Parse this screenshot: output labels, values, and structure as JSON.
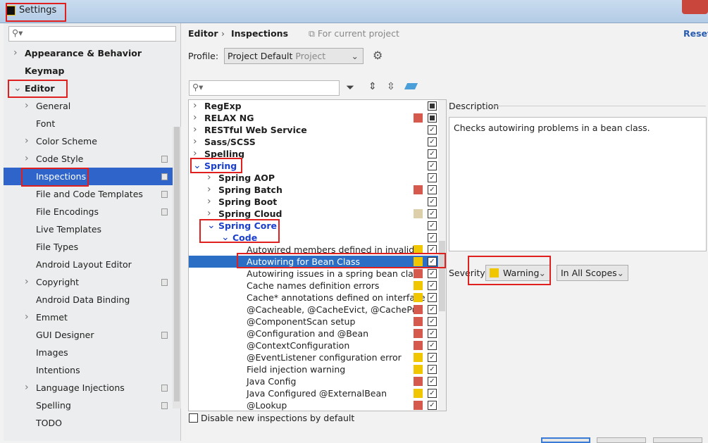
{
  "window": {
    "title": "Settings"
  },
  "sidebar": {
    "search_placeholder": "",
    "items": [
      {
        "label": "Appearance & Behavior",
        "level": 0,
        "bold": true,
        "chevron": "right"
      },
      {
        "label": "Keymap",
        "level": 0,
        "bold": true
      },
      {
        "label": "Editor",
        "level": 0,
        "bold": true,
        "chevron": "down"
      },
      {
        "label": "General",
        "level": 1,
        "chevron": "right"
      },
      {
        "label": "Font",
        "level": 1
      },
      {
        "label": "Color Scheme",
        "level": 1,
        "chevron": "right"
      },
      {
        "label": "Code Style",
        "level": 1,
        "chevron": "right",
        "copy": true
      },
      {
        "label": "Inspections",
        "level": 1,
        "selected": true,
        "copy": true
      },
      {
        "label": "File and Code Templates",
        "level": 1,
        "copy": true
      },
      {
        "label": "File Encodings",
        "level": 1,
        "copy": true
      },
      {
        "label": "Live Templates",
        "level": 1
      },
      {
        "label": "File Types",
        "level": 1
      },
      {
        "label": "Android Layout Editor",
        "level": 1
      },
      {
        "label": "Copyright",
        "level": 1,
        "chevron": "right",
        "copy": true
      },
      {
        "label": "Android Data Binding",
        "level": 1
      },
      {
        "label": "Emmet",
        "level": 1,
        "chevron": "right"
      },
      {
        "label": "GUI Designer",
        "level": 1,
        "copy": true
      },
      {
        "label": "Images",
        "level": 1
      },
      {
        "label": "Intentions",
        "level": 1
      },
      {
        "label": "Language Injections",
        "level": 1,
        "chevron": "right",
        "copy": true
      },
      {
        "label": "Spelling",
        "level": 1,
        "copy": true
      },
      {
        "label": "TODO",
        "level": 1
      }
    ]
  },
  "header": {
    "breadcrumb_1": "Editor",
    "separator": "›",
    "breadcrumb_2": "Inspections",
    "scope_note": "For current project",
    "reset": "Reset"
  },
  "profile": {
    "label": "Profile:",
    "value": "Project Default",
    "value_suffix": "Project"
  },
  "tree": {
    "search_placeholder": "",
    "rows": [
      {
        "label": "RegExp",
        "level": 0,
        "bold": true,
        "chevron": "right",
        "sev": "",
        "check": "partial"
      },
      {
        "label": "RELAX NG",
        "level": 0,
        "bold": true,
        "chevron": "right",
        "sev": "red",
        "check": "partial"
      },
      {
        "label": "RESTful Web Service",
        "level": 0,
        "bold": true,
        "chevron": "right",
        "sev": "",
        "check": "checked"
      },
      {
        "label": "Sass/SCSS",
        "level": 0,
        "bold": true,
        "chevron": "right",
        "sev": "",
        "check": "checked"
      },
      {
        "label": "Spelling",
        "level": 0,
        "bold": true,
        "chevron": "right",
        "sev": "",
        "check": "checked"
      },
      {
        "label": "Spring",
        "level": 0,
        "bold": true,
        "blue": true,
        "chevron": "down",
        "sev": "",
        "check": "checked"
      },
      {
        "label": "Spring AOP",
        "level": 1,
        "bold": true,
        "chevron": "right",
        "sev": "",
        "check": "checked"
      },
      {
        "label": "Spring Batch",
        "level": 1,
        "bold": true,
        "chevron": "right",
        "sev": "red",
        "check": "checked"
      },
      {
        "label": "Spring Boot",
        "level": 1,
        "bold": true,
        "chevron": "right",
        "sev": "",
        "check": "checked"
      },
      {
        "label": "Spring Cloud",
        "level": 1,
        "bold": true,
        "chevron": "right",
        "sev": "tan",
        "check": "checked"
      },
      {
        "label": "Spring Core",
        "level": 1,
        "bold": true,
        "blue": true,
        "chevron": "down",
        "sev": "",
        "check": "checked"
      },
      {
        "label": "Code",
        "level": 2,
        "bold": true,
        "blue": true,
        "chevron": "down",
        "sev": "",
        "check": "checked"
      },
      {
        "label": "Autowired members defined in invalid S",
        "level": 3,
        "sev": "yellow",
        "check": "checked"
      },
      {
        "label": "Autowiring for Bean Class",
        "level": 3,
        "sev": "yellow",
        "check": "checked",
        "selected": true
      },
      {
        "label": "Autowiring issues in a spring bean class",
        "level": 3,
        "sev": "red",
        "check": "checked"
      },
      {
        "label": "Cache names definition errors",
        "level": 3,
        "sev": "yellow",
        "check": "checked"
      },
      {
        "label": "Cache* annotations defined on interface",
        "level": 3,
        "sev": "yellow",
        "check": "checked"
      },
      {
        "label": "@Cacheable, @CacheEvict, @CachePut,",
        "level": 3,
        "sev": "red",
        "check": "checked"
      },
      {
        "label": "@ComponentScan setup",
        "level": 3,
        "sev": "red",
        "check": "checked"
      },
      {
        "label": "@Configuration and @Bean",
        "level": 3,
        "sev": "red",
        "check": "checked"
      },
      {
        "label": "@ContextConfiguration",
        "level": 3,
        "sev": "red",
        "check": "checked"
      },
      {
        "label": "@EventListener configuration error",
        "level": 3,
        "sev": "yellow",
        "check": "checked"
      },
      {
        "label": "Field injection warning",
        "level": 3,
        "sev": "yellow",
        "check": "checked"
      },
      {
        "label": "Java Config",
        "level": 3,
        "sev": "red",
        "check": "checked"
      },
      {
        "label": "Java Configured @ExternalBean",
        "level": 3,
        "sev": "yellow",
        "check": "checked"
      },
      {
        "label": "@Lookup",
        "level": 3,
        "sev": "red",
        "check": "checked"
      }
    ]
  },
  "description": {
    "title": "Description",
    "text": "Checks autowiring problems in a bean class."
  },
  "severity": {
    "label": "Severity:",
    "value": "Warning",
    "scope": "In All Scopes"
  },
  "footer": {
    "disable_new": "Disable new inspections by default"
  },
  "colors": {
    "red": "#d55a4d",
    "yellow": "#efc600",
    "tan": "#ddcfaa",
    "selection": "#2a6fc5",
    "blue_text": "#1a3fcc"
  }
}
